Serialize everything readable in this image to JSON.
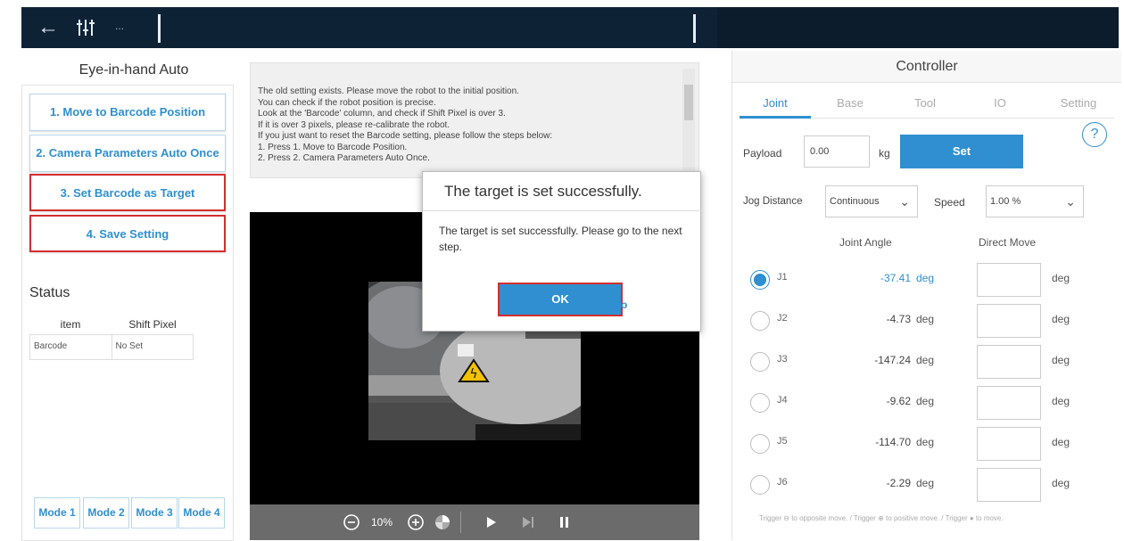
{
  "topbar": {
    "back_icon": "arrow-left-icon",
    "tune_icon": "sliders-icon",
    "more": "..."
  },
  "left_panel": {
    "title": "Eye-in-hand Auto",
    "steps": [
      "1. Move to Barcode Position",
      "2. Camera Parameters Auto Once",
      "3. Set Barcode as Target",
      "4. Save Setting"
    ],
    "status_title": "Status",
    "status_table": {
      "headers": [
        "item",
        "Shift Pixel"
      ],
      "rows": [
        [
          "Barcode",
          "No Set"
        ]
      ]
    },
    "modes": [
      "Mode 1",
      "Mode 2",
      "Mode 3",
      "Mode 4"
    ]
  },
  "message": {
    "text": "The old setting exists. Please move the robot to the initial position.\nYou can check if the robot position is precise.\nLook at the 'Barcode' column, and check if Shift Pixel is over 3.\nIf it is over 3 pixels, please re-calibrate the robot.\nIf you just want to reset the Barcode setting, please follow the steps below:\n1. Press 1. Move to Barcode Position.\n2. Press 2. Camera Parameters Auto Once."
  },
  "camera_bar": {
    "zoom": "10%"
  },
  "dialog": {
    "title": "The target is set successfully.",
    "body": "The target is set successfully. Please go to the next step.",
    "ok": "OK"
  },
  "controller": {
    "title": "Controller",
    "tabs": [
      "Joint",
      "Base",
      "Tool",
      "IO",
      "Setting"
    ],
    "active_tab": "Joint",
    "payload_label": "Payload",
    "payload_value": "0.00",
    "payload_unit": "kg",
    "set_label": "Set",
    "jog_label": "Jog Distance",
    "jog_value": "Continuous",
    "speed_label": "Speed",
    "speed_value": "1.00 %",
    "col_joint_angle": "Joint Angle",
    "col_direct_move": "Direct Move",
    "joints": [
      {
        "name": "J1",
        "value": "-37.41",
        "unit": "deg",
        "move_unit": "deg"
      },
      {
        "name": "J2",
        "value": "-4.73",
        "unit": "deg",
        "move_unit": "deg"
      },
      {
        "name": "J3",
        "value": "-147.24",
        "unit": "deg",
        "move_unit": "deg"
      },
      {
        "name": "J4",
        "value": "-9.62",
        "unit": "deg",
        "move_unit": "deg"
      },
      {
        "name": "J5",
        "value": "-114.70",
        "unit": "deg",
        "move_unit": "deg"
      },
      {
        "name": "J6",
        "value": "-2.29",
        "unit": "deg",
        "move_unit": "deg"
      }
    ],
    "footer": "Trigger ⊖ to opposite move.  /  Trigger ⊕ to positive move.  /  Trigger ● to move."
  },
  "colors": {
    "accent": "#2f8fd0",
    "highlight": "#d32f2f",
    "topbar": "#0e2236"
  }
}
